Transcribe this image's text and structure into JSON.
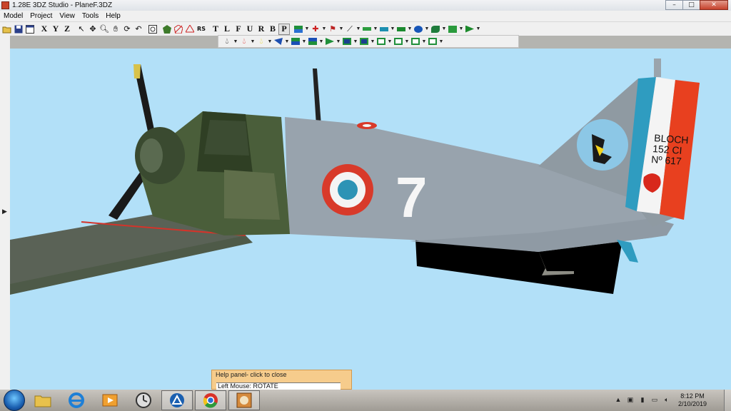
{
  "window": {
    "title": "1.28E 3DZ Studio - PlaneF.3DZ",
    "minimize_glyph": "–",
    "maximize_glyph": "□",
    "close_glyph": "✕"
  },
  "menu": [
    "Model",
    "Project",
    "View",
    "Tools",
    "Help"
  ],
  "toolbar": {
    "axis_buttons": [
      "X",
      "Y",
      "Z"
    ],
    "rs_label": "RS",
    "view_buttons": [
      "T",
      "L",
      "F",
      "U",
      "R",
      "B",
      "P"
    ],
    "pressed_view": "P"
  },
  "aircraft_markings": {
    "fuselage_number": "7",
    "tail_text_line1": "BLOCH",
    "tail_text_line2": "152 CI",
    "tail_text_line3": "Nº 617"
  },
  "help_panel": {
    "title": "Help panel- click to close",
    "line": "Left Mouse: ROTATE"
  },
  "taskbar": {
    "time": "8:12 PM",
    "date": "2/10/2019"
  },
  "colors": {
    "viewport_bg": "#b2e0f8",
    "fuselage_gray": "#9aa4ae",
    "camo_green": "#3f5530",
    "roundel_red": "#d83a2a",
    "roundel_blue": "#2d93b5",
    "tail_red": "#e8401f"
  }
}
